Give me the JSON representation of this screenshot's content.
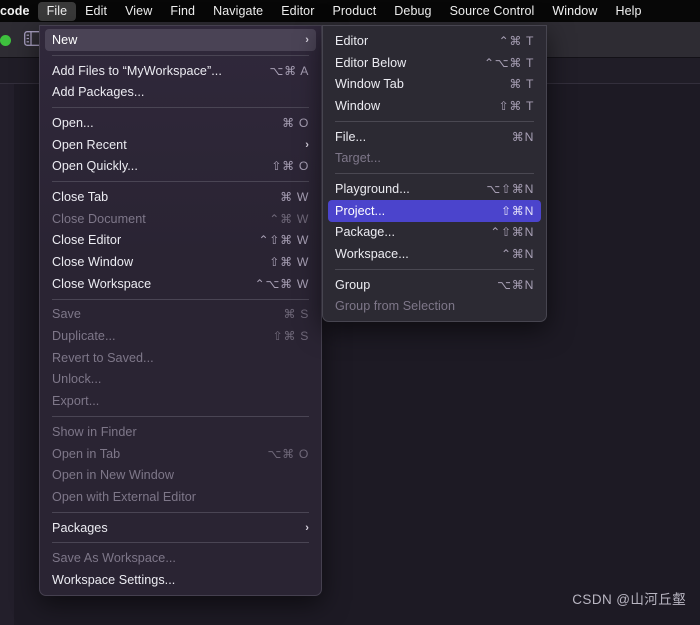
{
  "menubar": {
    "app_name": "code",
    "items": [
      {
        "label": "code",
        "active": false,
        "app": true
      },
      {
        "label": "File",
        "active": true
      },
      {
        "label": "Edit",
        "active": false
      },
      {
        "label": "View",
        "active": false
      },
      {
        "label": "Find",
        "active": false
      },
      {
        "label": "Navigate",
        "active": false
      },
      {
        "label": "Editor",
        "active": false
      },
      {
        "label": "Product",
        "active": false
      },
      {
        "label": "Debug",
        "active": false
      },
      {
        "label": "Source Control",
        "active": false
      },
      {
        "label": "Window",
        "active": false
      },
      {
        "label": "Help",
        "active": false
      }
    ]
  },
  "icons": {
    "traffic_light_green": "green-status-dot",
    "sidebar_toggle": "sidebar-toggle-icon"
  },
  "colors": {
    "menubar_bg": "#070707",
    "menu_bg": "#2b2533",
    "submenu_bg": "#2c2a33",
    "highlight_soft": "#4a4355",
    "highlight_blue": "#4b44cc",
    "accent_green": "#3ec13e",
    "text_primary": "#ececf2",
    "text_disabled": "#7e7789",
    "shortcut_text": "#a79fb4"
  },
  "file_menu": {
    "groups": [
      [
        {
          "label": "New",
          "shortcut": "",
          "submenu": true,
          "disabled": false,
          "highlight": "soft"
        }
      ],
      [
        {
          "label": "Add Files to “MyWorkspace”...",
          "shortcut": "⌥⌘ A",
          "submenu": false,
          "disabled": false
        },
        {
          "label": "Add Packages...",
          "shortcut": "",
          "submenu": false,
          "disabled": false
        }
      ],
      [
        {
          "label": "Open...",
          "shortcut": "⌘ O",
          "submenu": false,
          "disabled": false
        },
        {
          "label": "Open Recent",
          "shortcut": "",
          "submenu": true,
          "disabled": false
        },
        {
          "label": "Open Quickly...",
          "shortcut": "⇧⌘ O",
          "submenu": false,
          "disabled": false
        }
      ],
      [
        {
          "label": "Close Tab",
          "shortcut": "⌘ W",
          "submenu": false,
          "disabled": false
        },
        {
          "label": "Close Document",
          "shortcut": "⌃⌘ W",
          "submenu": false,
          "disabled": true
        },
        {
          "label": "Close Editor",
          "shortcut": "⌃⇧⌘ W",
          "submenu": false,
          "disabled": false
        },
        {
          "label": "Close Window",
          "shortcut": "⇧⌘ W",
          "submenu": false,
          "disabled": false
        },
        {
          "label": "Close Workspace",
          "shortcut": "⌃⌥⌘ W",
          "submenu": false,
          "disabled": false
        }
      ],
      [
        {
          "label": "Save",
          "shortcut": "⌘ S",
          "submenu": false,
          "disabled": true
        },
        {
          "label": "Duplicate...",
          "shortcut": "⇧⌘ S",
          "submenu": false,
          "disabled": true
        },
        {
          "label": "Revert to Saved...",
          "shortcut": "",
          "submenu": false,
          "disabled": true
        },
        {
          "label": "Unlock...",
          "shortcut": "",
          "submenu": false,
          "disabled": true
        },
        {
          "label": "Export...",
          "shortcut": "",
          "submenu": false,
          "disabled": true
        }
      ],
      [
        {
          "label": "Show in Finder",
          "shortcut": "",
          "submenu": false,
          "disabled": true
        },
        {
          "label": "Open in Tab",
          "shortcut": "⌥⌘ O",
          "submenu": false,
          "disabled": true
        },
        {
          "label": "Open in New Window",
          "shortcut": "",
          "submenu": false,
          "disabled": true
        },
        {
          "label": "Open with External Editor",
          "shortcut": "",
          "submenu": false,
          "disabled": true
        }
      ],
      [
        {
          "label": "Packages",
          "shortcut": "",
          "submenu": true,
          "disabled": false
        }
      ],
      [
        {
          "label": "Save As Workspace...",
          "shortcut": "",
          "submenu": false,
          "disabled": true
        },
        {
          "label": "Workspace Settings...",
          "shortcut": "",
          "submenu": false,
          "disabled": false
        }
      ]
    ]
  },
  "new_submenu": {
    "groups": [
      [
        {
          "label": "Editor",
          "shortcut": "⌃⌘ T",
          "disabled": false
        },
        {
          "label": "Editor Below",
          "shortcut": "⌃⌥⌘ T",
          "disabled": false
        },
        {
          "label": "Window Tab",
          "shortcut": "⌘ T",
          "disabled": false
        },
        {
          "label": "Window",
          "shortcut": "⇧⌘ T",
          "disabled": false
        }
      ],
      [
        {
          "label": "File...",
          "shortcut": "⌘N",
          "disabled": false
        },
        {
          "label": "Target...",
          "shortcut": "",
          "disabled": true
        }
      ],
      [
        {
          "label": "Playground...",
          "shortcut": "⌥⇧⌘N",
          "disabled": false
        },
        {
          "label": "Project...",
          "shortcut": "⇧⌘N",
          "disabled": false,
          "highlight": "blue"
        },
        {
          "label": "Package...",
          "shortcut": "⌃⇧⌘N",
          "disabled": false
        },
        {
          "label": "Workspace...",
          "shortcut": "⌃⌘N",
          "disabled": false
        }
      ],
      [
        {
          "label": "Group",
          "shortcut": "⌥⌘N",
          "disabled": false
        },
        {
          "label": "Group from Selection",
          "shortcut": "",
          "disabled": true
        }
      ]
    ]
  },
  "watermark": {
    "text": "CSDN @山河丘壑"
  }
}
